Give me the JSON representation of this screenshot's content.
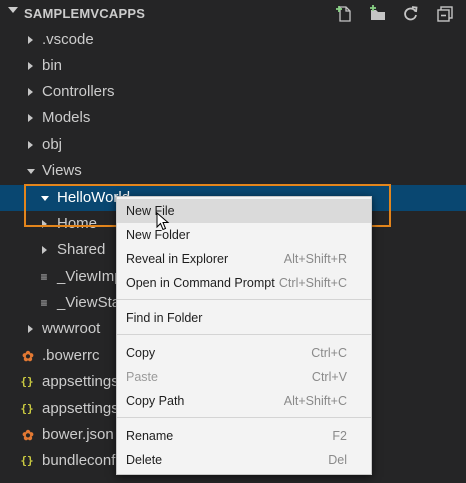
{
  "explorer": {
    "title": "SAMPLEMVCAPPS",
    "actions": [
      "new-file",
      "new-folder",
      "refresh",
      "collapse-all"
    ]
  },
  "tree": [
    {
      "label": ".vscode",
      "kind": "folder",
      "state": "closed"
    },
    {
      "label": "bin",
      "kind": "folder",
      "state": "closed"
    },
    {
      "label": "Controllers",
      "kind": "folder",
      "state": "closed"
    },
    {
      "label": "Models",
      "kind": "folder",
      "state": "closed"
    },
    {
      "label": "obj",
      "kind": "folder",
      "state": "closed"
    },
    {
      "label": "Views",
      "kind": "folder",
      "state": "open"
    },
    {
      "label": "HelloWorld",
      "kind": "folder",
      "state": "open",
      "selected": true
    },
    {
      "label": "Home",
      "kind": "folder",
      "state": "closed"
    },
    {
      "label": "Shared",
      "kind": "folder",
      "state": "closed"
    },
    {
      "label": "_ViewImports.cshtml",
      "kind": "file",
      "icon": "lines"
    },
    {
      "label": "_ViewStart.cshtml",
      "kind": "file",
      "icon": "lines"
    },
    {
      "label": "wwwroot",
      "kind": "folder",
      "state": "closed"
    },
    {
      "label": ".bowerrc",
      "kind": "file",
      "icon": "bower"
    },
    {
      "label": "appsettings.json",
      "kind": "file",
      "icon": "braces"
    },
    {
      "label": "appsettings.Development.json",
      "kind": "file",
      "icon": "braces"
    },
    {
      "label": "bower.json",
      "kind": "file",
      "icon": "bower"
    },
    {
      "label": "bundleconfig.json",
      "kind": "file",
      "icon": "braces"
    }
  ],
  "context_menu": {
    "items": [
      {
        "label": "New File",
        "shortcut": "",
        "highlighted": true
      },
      {
        "label": "New Folder",
        "shortcut": ""
      },
      {
        "label": "Reveal in Explorer",
        "shortcut": "Alt+Shift+R"
      },
      {
        "label": "Open in Command Prompt",
        "shortcut": "Ctrl+Shift+C"
      },
      {
        "label": "Find in Folder",
        "shortcut": ""
      },
      {
        "label": "Copy",
        "shortcut": "Ctrl+C"
      },
      {
        "label": "Paste",
        "shortcut": "Ctrl+V",
        "disabled": true
      },
      {
        "label": "Copy Path",
        "shortcut": "Alt+Shift+C"
      },
      {
        "label": "Rename",
        "shortcut": "F2"
      },
      {
        "label": "Delete",
        "shortcut": "Del"
      }
    ]
  },
  "colors": {
    "background": "#252526",
    "selection": "#094771",
    "focus_outline": "#e3851c",
    "menu_background": "#f3f3f3"
  }
}
